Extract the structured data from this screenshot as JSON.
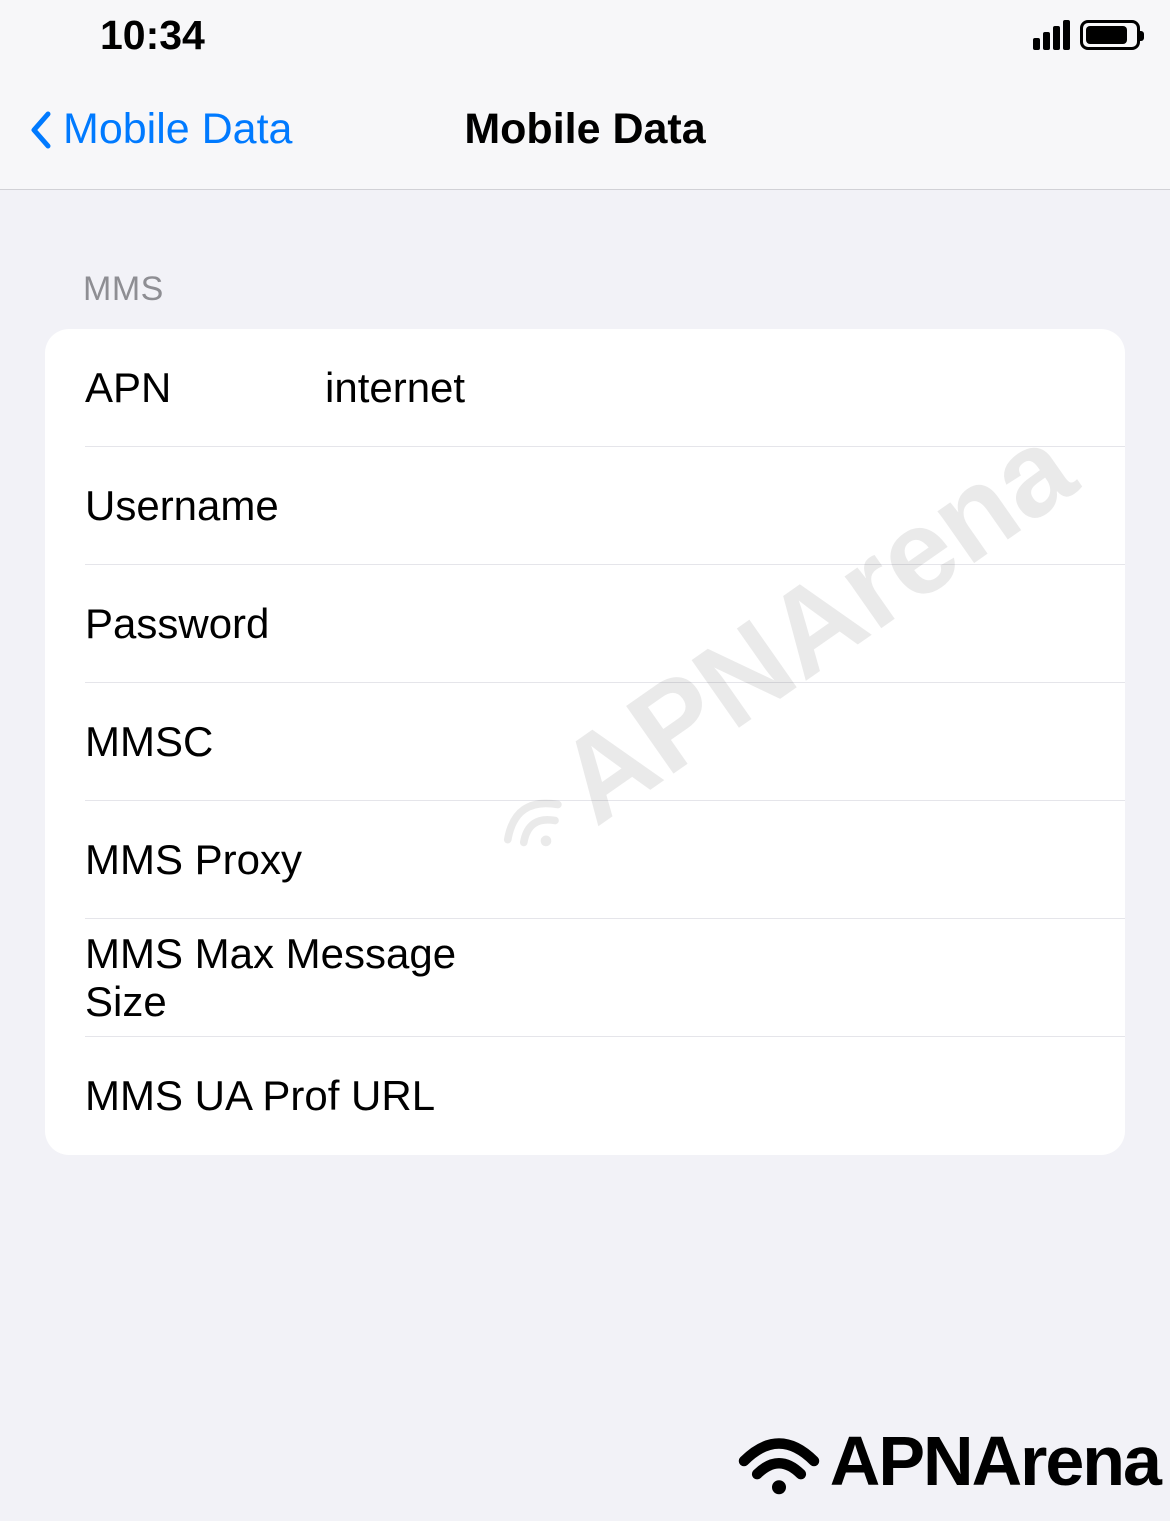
{
  "statusBar": {
    "time": "10:34"
  },
  "navBar": {
    "backLabel": "Mobile Data",
    "title": "Mobile Data"
  },
  "section": {
    "header": "MMS",
    "rows": {
      "apn": {
        "label": "APN",
        "value": "internet"
      },
      "username": {
        "label": "Username",
        "value": ""
      },
      "password": {
        "label": "Password",
        "value": ""
      },
      "mmsc": {
        "label": "MMSC",
        "value": ""
      },
      "mmsProxy": {
        "label": "MMS Proxy",
        "value": ""
      },
      "mmsMaxSize": {
        "label": "MMS Max Message Size",
        "value": ""
      },
      "mmsUaProf": {
        "label": "MMS UA Prof URL",
        "value": ""
      }
    }
  },
  "brand": {
    "name": "APNArena"
  }
}
